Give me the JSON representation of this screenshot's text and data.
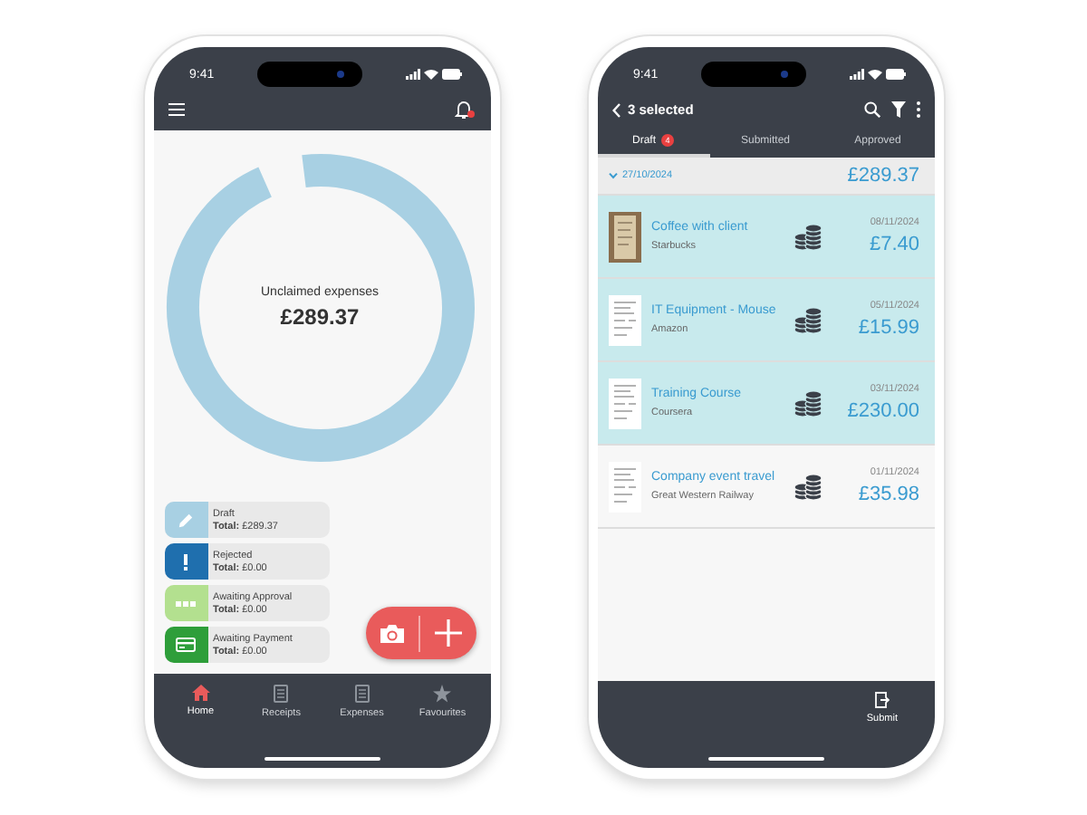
{
  "home_screen": {
    "time": "9:41",
    "notification_unread": true,
    "summary": {
      "label": "Unclaimed expenses",
      "amount": "£289.37"
    },
    "statuses": [
      {
        "kind": "pencil",
        "label": "Draft",
        "total": "**Total:** £289.37",
        "color": "#a8d0e3"
      },
      {
        "kind": "alert",
        "label": "Rejected",
        "total": "**Total:** £0.00",
        "color": "#1f6fae"
      },
      {
        "kind": "dots",
        "label": "Awaiting Approval",
        "total": "**Total:** £0.00",
        "color": "#b3e08f"
      },
      {
        "kind": "card",
        "label": "Awaiting Payment",
        "total": "**Total:** £0.00",
        "color": "#2e9e3a"
      }
    ],
    "nav": [
      {
        "kind": "home",
        "label": "Home",
        "selected": true
      },
      {
        "kind": "receipt",
        "label": "Receipts",
        "selected": false
      },
      {
        "kind": "receipt",
        "label": "Expenses",
        "selected": false
      },
      {
        "kind": "star",
        "label": "Favourites",
        "selected": false
      }
    ]
  },
  "list_screen": {
    "time": "9:41",
    "title": "3 selected",
    "tabs": [
      {
        "label": "Draft",
        "badge": "4",
        "selected": true
      },
      {
        "label": "Submitted",
        "selected": false
      },
      {
        "label": "Approved",
        "selected": false
      }
    ],
    "group": {
      "date": "27/10/2024",
      "total": "£289.37",
      "expanded": true
    },
    "items": [
      {
        "kind": "photo",
        "title": "Coffee with client",
        "merchant": "Starbucks",
        "date": "08/11/2024",
        "amount": "£7.40",
        "selected": true
      },
      {
        "kind": "scan",
        "title": "IT Equipment - Mouse",
        "merchant": "Amazon",
        "date": "05/11/2024",
        "amount": "£15.99",
        "selected": true
      },
      {
        "kind": "scan",
        "title": "Training Course",
        "merchant": "Coursera",
        "date": "03/11/2024",
        "amount": "£230.00",
        "selected": true
      },
      {
        "kind": "scan",
        "title": "Company event travel",
        "merchant": "Great Western Railway",
        "date": "01/11/2024",
        "amount": "£35.98",
        "selected": false
      }
    ],
    "action": {
      "label": "Submit"
    }
  }
}
